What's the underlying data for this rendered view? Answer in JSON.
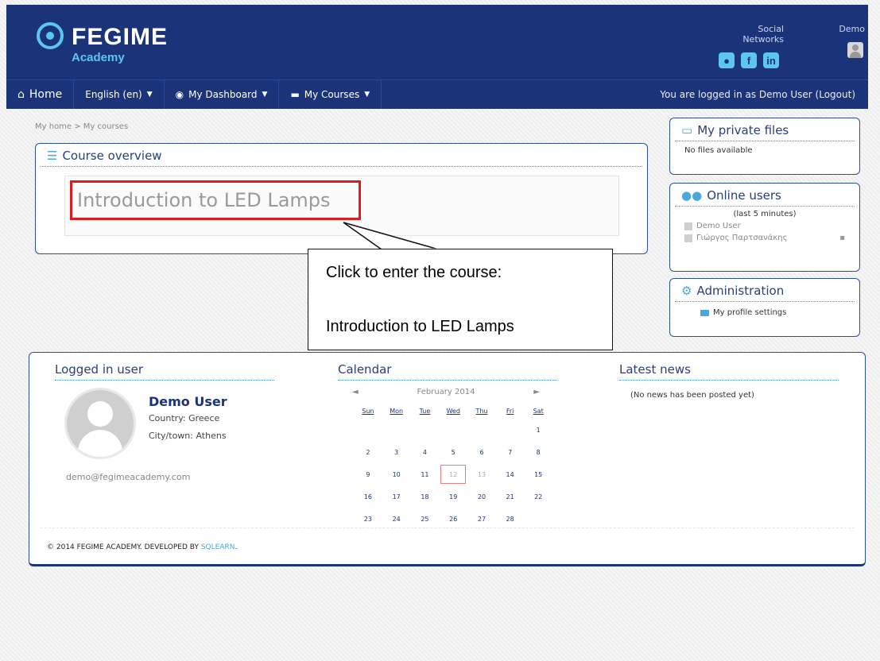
{
  "header": {
    "brand": "FEGIME",
    "subbrand": "Academy",
    "social_label": "Social Networks",
    "social_icons": [
      "skype-icon",
      "facebook-icon",
      "linkedin-icon"
    ],
    "user_label": "Demo"
  },
  "nav": {
    "home": "Home",
    "language": "English (en)",
    "dashboard": "My Dashboard",
    "courses": "My Courses",
    "login_status": "You are logged in as Demo User (Logout)"
  },
  "breadcrumb": "My home > My courses",
  "course_overview": {
    "title": "Course overview",
    "course_name": "Introduction to LED Lamps"
  },
  "callout": {
    "line1": "Click to enter the course:",
    "line2": "Introduction to LED Lamps"
  },
  "private_files": {
    "title": "My private files",
    "text": "No files available"
  },
  "online_users": {
    "title": "Online users",
    "subtitle": "(last 5 minutes)",
    "users": [
      "Demo User",
      "Γιώργος Παρτσανάκης"
    ]
  },
  "administration": {
    "title": "Administration",
    "item": "My profile settings"
  },
  "logged_in_user": {
    "title": "Logged in user",
    "name": "Demo User",
    "country": "Country: Greece",
    "city": "City/town: Athens",
    "email": "demo@fegimeacademy.com"
  },
  "calendar": {
    "title": "Calendar",
    "month": "February 2014",
    "prev": "◄",
    "next": "►",
    "weekdays": [
      "Sun",
      "Mon",
      "Tue",
      "Wed",
      "Thu",
      "Fri",
      "Sat"
    ],
    "weeks": [
      [
        "",
        "",
        "",
        "",
        "",
        "",
        "1"
      ],
      [
        "2",
        "3",
        "4",
        "5",
        "6",
        "7",
        "8"
      ],
      [
        "9",
        "10",
        "11",
        "12",
        "13",
        "14",
        "15"
      ],
      [
        "16",
        "17",
        "18",
        "19",
        "20",
        "21",
        "22"
      ],
      [
        "23",
        "24",
        "25",
        "26",
        "27",
        "28",
        ""
      ]
    ],
    "today": "12"
  },
  "latest_news": {
    "title": "Latest news",
    "text": "(No news has been posted yet)"
  },
  "footer": {
    "copyright": "© 2014 FEGIME ACADEMY. DEVELOPED BY",
    "developer": "SQLEARN",
    "end": "."
  },
  "colors": {
    "header_bg": "#1b3479",
    "accent": "#5cc6ee",
    "highlight_border": "#e01b1b"
  }
}
